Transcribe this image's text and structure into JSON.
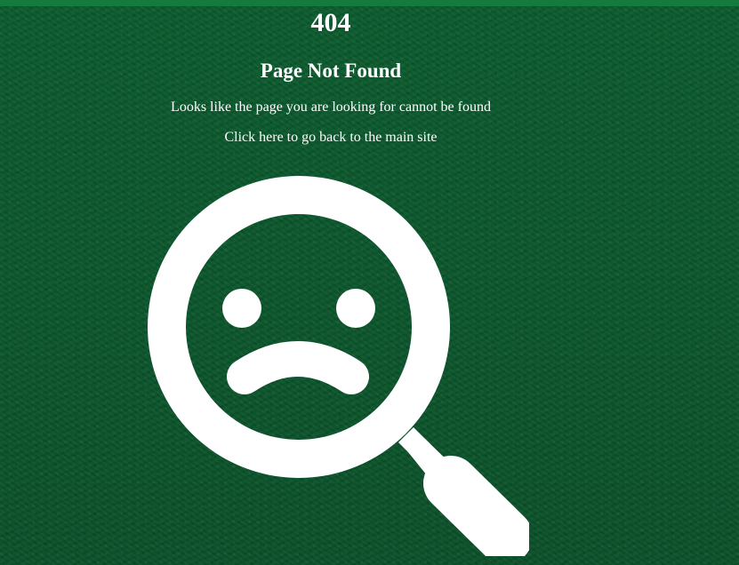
{
  "error": {
    "code": "404",
    "title": "Page Not Found",
    "message": "Looks like the page you are looking for cannot be found",
    "back_link_label": "Click here to go back to the main site"
  },
  "illustration": {
    "icon": "sad-magnifying-glass-icon"
  },
  "colors": {
    "background": "#0d5a2e",
    "top_strip": "#147a3d",
    "text": "#ffffff"
  }
}
